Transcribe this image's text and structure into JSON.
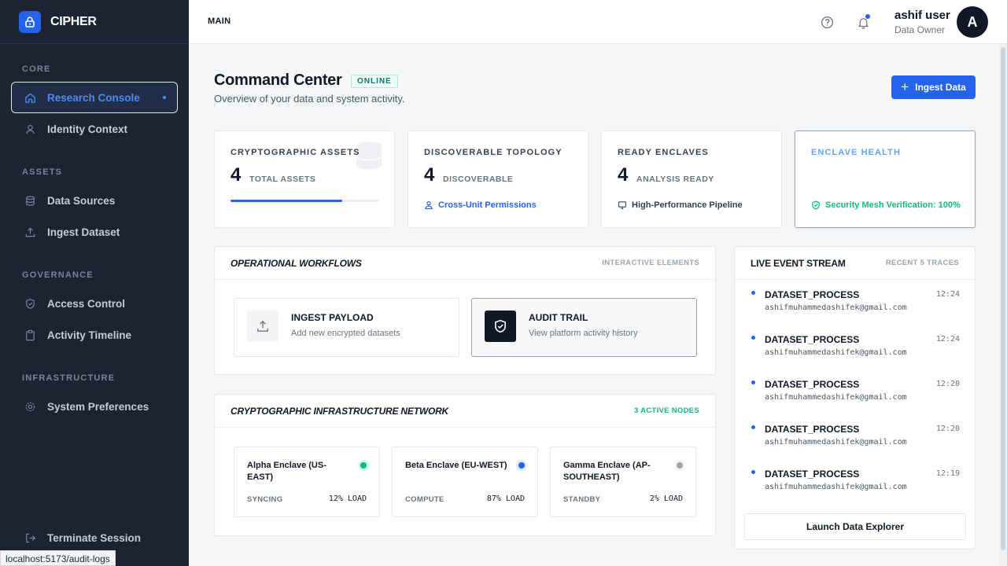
{
  "app": {
    "name": "CIPHER"
  },
  "sidebar": {
    "sections": [
      "CORE",
      "ASSETS",
      "GOVERNANCE",
      "INFRASTRUCTURE"
    ],
    "items": [
      {
        "label": "Research Console",
        "icon": "home-icon",
        "active": true
      },
      {
        "label": "Identity Context",
        "icon": "user-icon"
      },
      {
        "label": "Data Sources",
        "icon": "database-icon"
      },
      {
        "label": "Ingest Dataset",
        "icon": "upload-icon"
      },
      {
        "label": "Access Control",
        "icon": "shield-icon"
      },
      {
        "label": "Activity Timeline",
        "icon": "clipboard-icon"
      },
      {
        "label": "System Preferences",
        "icon": "gear-icon"
      }
    ],
    "logout": "Terminate Session"
  },
  "topbar": {
    "breadcrumb": "MAIN",
    "user": {
      "name": "ashif user",
      "role": "Data Owner",
      "initial": "A"
    }
  },
  "header": {
    "title": "Command Center",
    "badge": "ONLINE",
    "subtitle": "Overview of your data and system activity.",
    "ingest_button": "Ingest Data"
  },
  "stats": [
    {
      "label": "CRYPTOGRAPHIC ASSETS",
      "value": "4",
      "unit": "TOTAL ASSETS",
      "progress": 0.75
    },
    {
      "label": "DISCOVERABLE TOPOLOGY",
      "value": "4",
      "unit": "DISCOVERABLE",
      "foot": "Cross-Unit Permissions"
    },
    {
      "label": "READY ENCLAVES",
      "value": "4",
      "unit": "ANALYSIS READY",
      "foot": "High-Performance Pipeline"
    },
    {
      "label": "ENCLAVE HEALTH",
      "foot": "Security Mesh Verification: 100%"
    }
  ],
  "workflows": {
    "title": "OPERATIONAL WORKFLOWS",
    "meta": "INTERACTIVE ELEMENTS",
    "items": [
      {
        "title": "INGEST PAYLOAD",
        "desc": "Add new encrypted datasets"
      },
      {
        "title": "AUDIT TRAIL",
        "desc": "View platform activity history"
      }
    ]
  },
  "network": {
    "title": "CRYPTOGRAPHIC INFRASTRUCTURE NETWORK",
    "meta": "3 ACTIVE NODES",
    "nodes": [
      {
        "name": "Alpha Enclave (US-EAST)",
        "status": "SYNCING",
        "load": "12% LOAD",
        "color": "#10b981"
      },
      {
        "name": "Beta Enclave (EU-WEST)",
        "status": "COMPUTE",
        "load": "87% LOAD",
        "color": "#2563eb"
      },
      {
        "name": "Gamma Enclave (AP-SOUTHEAST)",
        "status": "STANDBY",
        "load": "2% LOAD",
        "color": "#9ca3af"
      }
    ]
  },
  "events": {
    "title": "LIVE EVENT STREAM",
    "meta": "RECENT 5 TRACES",
    "items": [
      {
        "name": "DATASET_PROCESS",
        "time": "12:24",
        "user": "ashifmuhammedashifek@gmail.com"
      },
      {
        "name": "DATASET_PROCESS",
        "time": "12:24",
        "user": "ashifmuhammedashifek@gmail.com"
      },
      {
        "name": "DATASET_PROCESS",
        "time": "12:20",
        "user": "ashifmuhammedashifek@gmail.com"
      },
      {
        "name": "DATASET_PROCESS",
        "time": "12:20",
        "user": "ashifmuhammedashifek@gmail.com"
      },
      {
        "name": "DATASET_PROCESS",
        "time": "12:19",
        "user": "ashifmuhammedashifek@gmail.com"
      }
    ],
    "launch_button": "Launch Data Explorer"
  },
  "status_url": "localhost:5173/audit-logs",
  "colors": {
    "accent": "#2563eb",
    "success": "#10b981",
    "sidebar": "#1c2333"
  }
}
